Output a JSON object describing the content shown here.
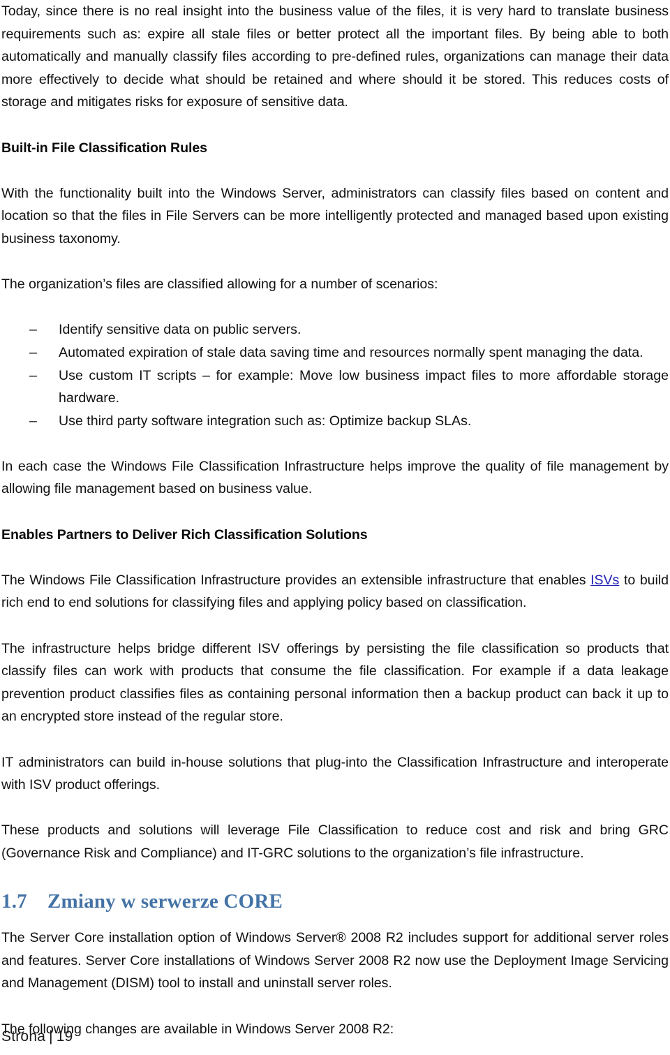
{
  "document": {
    "page_number": "19",
    "footer": {
      "label": "Strona",
      "separator": "|",
      "number": "19"
    },
    "link_color": "#2020b5",
    "heading_color": "#4473a6",
    "body_color": "#111111"
  },
  "blocks": {
    "para_intro": "Today, since there is no real insight into the business value of the files, it is very hard to translate business requirements such as: expire all stale files or better protect all the important files. By being able to both automatically and manually classify files according to pre-defined rules, organizations can manage their data more effectively to decide what should be retained and where should it be stored. This reduces costs of storage and mitigates risks for exposure of sensitive data.",
    "subhead_builtin": "Built-in File Classification Rules",
    "para_builtin": "With the functionality built into the Windows Server, administrators can classify files based on content and location so that the files in File Servers can be more intelligently protected and managed based upon existing business taxonomy.",
    "para_scenarios_lead": "The organization’s files are classified allowing for a number of scenarios:",
    "scenarios_marker": "–",
    "scenarios": [
      "Identify sensitive data on public servers.",
      "Automated expiration of stale data saving time and resources normally spent managing the data.",
      "Use custom IT scripts – for example: Move low business impact files to more affordable storage hardware.",
      "Use third party software integration such as: Optimize backup SLAs."
    ],
    "para_each_case": "In each case the Windows File Classification Infrastructure helps improve the quality of file management by allowing file management based on business value.",
    "subhead_partners": "Enables Partners to Deliver Rich Classification Solutions",
    "para_partners_pre": "The Windows File Classification Infrastructure provides an extensible infrastructure that enables ",
    "para_partners_link": "ISVs",
    "para_partners_post": " to build rich end to end solutions for classifying files and applying policy based on classification.",
    "para_bridge": "The infrastructure helps bridge different ISV offerings by persisting the file classification so products that classify files can work with products that consume the file classification. For example if a data leakage prevention product classifies files as containing personal information then a backup product can back it up to an encrypted store instead of the regular store.",
    "para_it_admins": "IT administrators can build in-house solutions that plug-into the Classification Infrastructure and interoperate with ISV product offerings.",
    "para_grc": "These products and solutions will leverage File Classification to reduce cost and risk and bring GRC (Governance Risk and Compliance) and IT-GRC solutions to the organization’s file infrastructure.",
    "section_number": "1.7",
    "section_title": "Zmiany w serwerze CORE",
    "para_server_core": "The Server Core installation option of Windows Server® 2008 R2 includes support for additional server roles and features. Server Core installations of Windows Server 2008 R2 now use the Deployment Image Servicing and Management (DISM) tool to install and uninstall server roles.",
    "para_following_changes": "The following changes are available in Windows Server 2008 R2:"
  }
}
